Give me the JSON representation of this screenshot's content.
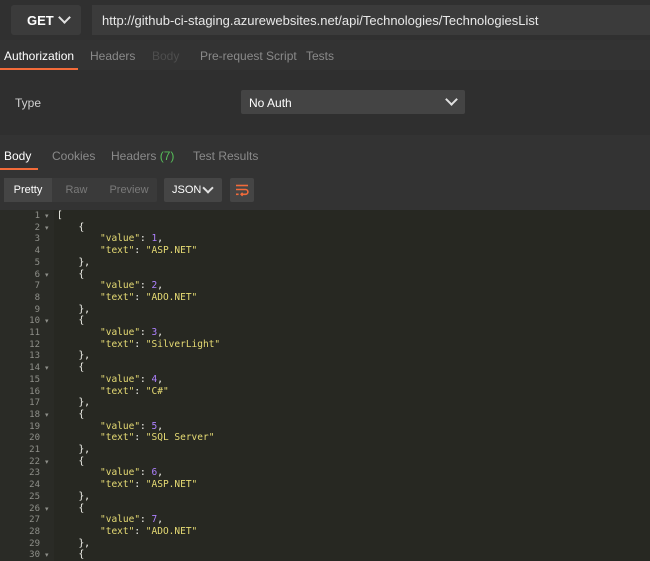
{
  "request": {
    "method": "GET",
    "url": "http://github-ci-staging.azurewebsites.net/api/Technologies/TechnologiesList"
  },
  "request_tabs": [
    {
      "label": "Authorization",
      "state": "active"
    },
    {
      "label": "Headers",
      "state": "normal"
    },
    {
      "label": "Body",
      "state": "disabled"
    },
    {
      "label": "Pre-request Script",
      "state": "normal"
    },
    {
      "label": "Tests",
      "state": "normal"
    }
  ],
  "auth": {
    "type_label": "Type",
    "type_value": "No Auth"
  },
  "response_tabs": [
    {
      "label": "Body",
      "state": "active"
    },
    {
      "label": "Cookies",
      "state": "normal"
    },
    {
      "label": "Headers",
      "count": "(7)",
      "state": "normal"
    },
    {
      "label": "Test Results",
      "state": "normal"
    }
  ],
  "view_modes": [
    "Pretty",
    "Raw",
    "Preview"
  ],
  "active_view_mode": "Pretty",
  "format": "JSON",
  "response_lines": [
    {
      "num": "1",
      "fold": true,
      "indent": 0,
      "text": "["
    },
    {
      "num": "2",
      "fold": true,
      "indent": 1,
      "text": "{"
    },
    {
      "num": "3",
      "indent": 2,
      "key": "\"value\"",
      "num_value": "1",
      "tail": ","
    },
    {
      "num": "4",
      "indent": 2,
      "key": "\"text\"",
      "str_value": "\"ASP.NET\""
    },
    {
      "num": "5",
      "indent": 1,
      "text": "},"
    },
    {
      "num": "6",
      "fold": true,
      "indent": 1,
      "text": "{"
    },
    {
      "num": "7",
      "indent": 2,
      "key": "\"value\"",
      "num_value": "2",
      "tail": ","
    },
    {
      "num": "8",
      "indent": 2,
      "key": "\"text\"",
      "str_value": "\"ADO.NET\""
    },
    {
      "num": "9",
      "indent": 1,
      "text": "},"
    },
    {
      "num": "10",
      "fold": true,
      "indent": 1,
      "text": "{"
    },
    {
      "num": "11",
      "indent": 2,
      "key": "\"value\"",
      "num_value": "3",
      "tail": ","
    },
    {
      "num": "12",
      "indent": 2,
      "key": "\"text\"",
      "str_value": "\"SilverLight\""
    },
    {
      "num": "13",
      "indent": 1,
      "text": "},"
    },
    {
      "num": "14",
      "fold": true,
      "indent": 1,
      "text": "{"
    },
    {
      "num": "15",
      "indent": 2,
      "key": "\"value\"",
      "num_value": "4",
      "tail": ","
    },
    {
      "num": "16",
      "indent": 2,
      "key": "\"text\"",
      "str_value": "\"C#\""
    },
    {
      "num": "17",
      "indent": 1,
      "text": "},"
    },
    {
      "num": "18",
      "fold": true,
      "indent": 1,
      "text": "{"
    },
    {
      "num": "19",
      "indent": 2,
      "key": "\"value\"",
      "num_value": "5",
      "tail": ","
    },
    {
      "num": "20",
      "indent": 2,
      "key": "\"text\"",
      "str_value": "\"SQL Server\""
    },
    {
      "num": "21",
      "indent": 1,
      "text": "},"
    },
    {
      "num": "22",
      "fold": true,
      "indent": 1,
      "text": "{"
    },
    {
      "num": "23",
      "indent": 2,
      "key": "\"value\"",
      "num_value": "6",
      "tail": ","
    },
    {
      "num": "24",
      "indent": 2,
      "key": "\"text\"",
      "str_value": "\"ASP.NET\""
    },
    {
      "num": "25",
      "indent": 1,
      "text": "},"
    },
    {
      "num": "26",
      "fold": true,
      "indent": 1,
      "text": "{"
    },
    {
      "num": "27",
      "indent": 2,
      "key": "\"value\"",
      "num_value": "7",
      "tail": ","
    },
    {
      "num": "28",
      "indent": 2,
      "key": "\"text\"",
      "str_value": "\"ADO.NET\""
    },
    {
      "num": "29",
      "indent": 1,
      "text": "},"
    },
    {
      "num": "30",
      "fold": true,
      "indent": 1,
      "text": "{"
    }
  ],
  "colors": {
    "accent": "#f26b3a",
    "count_badge": "#57c05a",
    "editor_bg": "#272822",
    "json_key": "#e6db74",
    "json_number": "#ae81ff"
  },
  "icons": {
    "method_dropdown": "chevron-down-icon",
    "auth_dropdown": "chevron-down-icon",
    "format_dropdown": "chevron-down-icon",
    "wrap": "wrap-lines-icon",
    "fold": "fold-arrow-icon"
  }
}
